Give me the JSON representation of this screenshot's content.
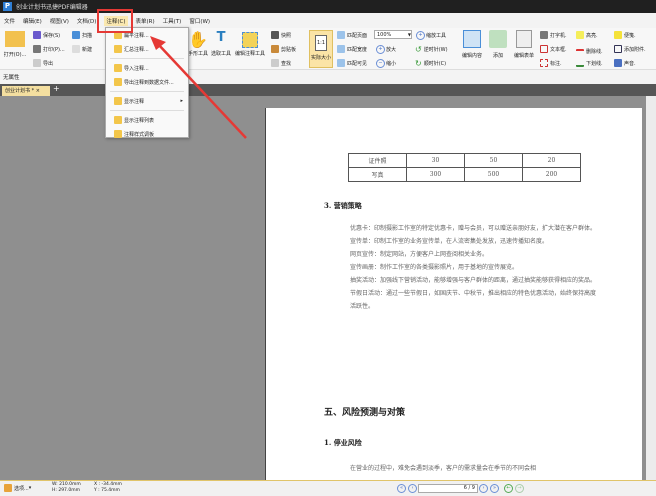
{
  "title": "创业计划书迅捷PDF编辑器",
  "menu": [
    "文件",
    "编辑(E)",
    "视图(V)",
    "文档(D)",
    "注释(C)",
    "表单(R)",
    "工具(T)",
    "窗口(W)"
  ],
  "ribbon": {
    "open": "打开(O)...",
    "save": "保存(S)",
    "print": "打印(P)...",
    "export": "导出",
    "scan": "扫描",
    "new": "新建",
    "hand": "手形工具",
    "select_text": "选取工具",
    "edit_annot": "编辑注释工具",
    "snapshot": "快照",
    "clipboard": "剪贴板",
    "find": "查找",
    "actual_size": "实际大小",
    "fit_page": "匹配页面",
    "fit_width": "匹配宽度",
    "fit_visible": "匹配可见",
    "zoom_value": "100%",
    "zoom_in": "放大",
    "zoom_out": "缩小",
    "zoom_tool": "缩放工具",
    "rotate_ccw": "逆时针(W)",
    "rotate_cw": "顺时针(C)",
    "edit_content": "编辑内容",
    "add": "添加",
    "edit_form": "编辑表单",
    "typewriter": "打字机.",
    "textbox": "文本框.",
    "callout": "标注.",
    "highlight": "高亮.",
    "strikeout": "删除线.",
    "underline": "下划线.",
    "note": "便笺.",
    "attach": "添加附件.",
    "sound": "声音."
  },
  "propbar": "无属性",
  "tab": {
    "label": "创业计划书 *"
  },
  "dropdown": [
    "扁平注释...",
    "汇总注释...",
    "导入注释...",
    "导出注释到数据文件...",
    "显示注释",
    "显示注释列表",
    "注释样式调板"
  ],
  "doc": {
    "table": [
      [
        "证件照",
        "30",
        "50",
        "20"
      ],
      [
        "写真",
        "300",
        "500",
        "200"
      ]
    ],
    "h_marketing": "3. 营销策略",
    "paras": [
      "优惠卡：印制摄影工作室的特定优惠卡，赠与会员，可以赠送亲朋好友，扩大潜在客户群体。",
      "宣传单：印制工作室的业务宣传单，在人流密集处发放，迅速传播知名度。",
      "网页宣传：制定网站，方便客户上网查阅相关业务。",
      "宣传画册：制作工作室的各类摄影照片，用于基地的宣传展览。",
      "抽奖活动：加强线下营销活动，能够增强与客户群体的距离，通过抽奖能够获得相应的奖品。",
      "节假日活动：通过一些节假日，如国庆节、中秋节，推出相应的特色优惠活动，始终保持高度活跃性。"
    ],
    "h_risk": "五、风险预测与对策",
    "h_stop": "1. 停业风险",
    "last": "在营业的过程中，难免会遇到淡季，客户的需求量会在季节的不同会相"
  },
  "status": {
    "select": "选项...",
    "w": "W: 210.0mm",
    "h": "H: 297.0mm",
    "x": "X : -34.4mm",
    "y": "Y : 75.4mm",
    "page": "6 / 9"
  },
  "colors": {
    "highlight_box": "#e53935",
    "arrow": "#e53935"
  }
}
